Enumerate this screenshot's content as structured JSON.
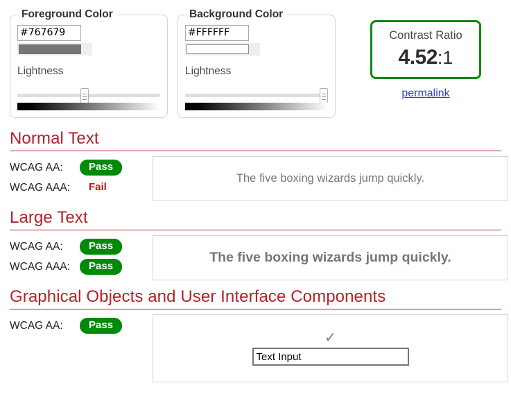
{
  "foreground": {
    "legend": "Foreground Color",
    "hex_value": "#767679",
    "swatch_color": "#767679",
    "lightness_label": "Lightness",
    "lightness_percent": 47
  },
  "background": {
    "legend": "Background Color",
    "hex_value": "#FFFFFF",
    "swatch_color": "#FFFFFF",
    "lightness_label": "Lightness",
    "lightness_percent": 100
  },
  "contrast": {
    "title": "Contrast Ratio",
    "value": "4.52",
    "suffix": ":1",
    "border_color": "#118811",
    "permalink_label": "permalink",
    "permalink_color": "#2b42c8"
  },
  "sections": [
    {
      "heading": "Normal Text",
      "criteria": [
        {
          "label": "WCAG AA:",
          "result": "Pass",
          "status": "pass"
        },
        {
          "label": "WCAG AAA:",
          "result": "Fail",
          "status": "fail"
        }
      ],
      "sample_text": "The five boxing wizards jump quickly.",
      "sample_style": "normal"
    },
    {
      "heading": "Large Text",
      "criteria": [
        {
          "label": "WCAG AA:",
          "result": "Pass",
          "status": "pass"
        },
        {
          "label": "WCAG AAA:",
          "result": "Pass",
          "status": "pass"
        }
      ],
      "sample_text": "The five boxing wizards jump quickly.",
      "sample_style": "large"
    },
    {
      "heading": "Graphical Objects and User Interface Components",
      "criteria": [
        {
          "label": "WCAG AA:",
          "result": "Pass",
          "status": "pass"
        }
      ],
      "check_icon": "✓",
      "input_value": "Text Input",
      "sample_style": "ui"
    }
  ],
  "colors": {
    "heading": "#b5212a",
    "pass_badge": "#008a08",
    "fail_text": "#c01616",
    "sample_text": "#767679"
  }
}
